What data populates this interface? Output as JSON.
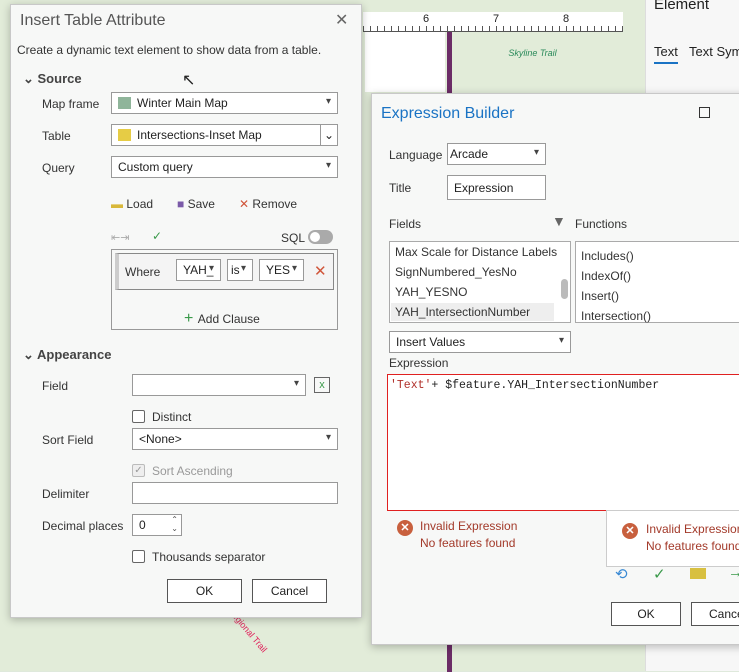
{
  "background": {
    "ruler_ticks": [
      "6",
      "7",
      "8"
    ],
    "map_label": "Skyline Trail",
    "map_label2": "Regional Trail",
    "panel_title": "Element",
    "panel_tabs": [
      "Text",
      "Text Sym"
    ]
  },
  "insert_table": {
    "title": "Insert Table Attribute",
    "description": "Create a dynamic text element to show data from a table.",
    "source": {
      "header": "Source",
      "map_frame_label": "Map frame",
      "map_frame_value": "Winter Main Map",
      "table_label": "Table",
      "table_value": "Intersections-Inset Map",
      "query_label": "Query",
      "query_value": "Custom query",
      "load": "Load",
      "save": "Save",
      "remove": "Remove",
      "sql_label": "SQL",
      "clause": {
        "where": "Where",
        "field": "YAH_",
        "operator": "is",
        "value": "YES"
      },
      "add_clause": "Add Clause"
    },
    "appearance": {
      "header": "Appearance",
      "field_label": "Field",
      "field_value": "",
      "distinct": "Distinct",
      "sort_field_label": "Sort Field",
      "sort_field_value": "<None>",
      "sort_ascending": "Sort Ascending",
      "delimiter_label": "Delimiter",
      "delimiter_value": "",
      "decimal_label": "Decimal places",
      "decimal_value": "0",
      "thousands": "Thousands separator"
    },
    "ok": "OK",
    "cancel": "Cancel"
  },
  "expression_builder": {
    "title": "Expression Builder",
    "language_label": "Language",
    "language_value": "Arcade",
    "title_label": "Title",
    "title_value": "Expression",
    "fields_label": "Fields",
    "functions_label": "Functions",
    "fields": [
      "Max Scale for Distance Labels",
      "SignNumbered_YesNo",
      "YAH_YESNO",
      "YAH_IntersectionNumber"
    ],
    "functions": [
      "Includes()",
      "IndexOf()",
      "Insert()",
      "Intersection()"
    ],
    "insert_values": "Insert Values",
    "expression_label": "Expression",
    "expr_string": "'Text'",
    "expr_rest": "+ $feature.YAH_IntersectionNumber",
    "error_title": "Invalid Expression",
    "error_detail": "No features found",
    "ok": "OK",
    "cancel": "Cancel"
  }
}
